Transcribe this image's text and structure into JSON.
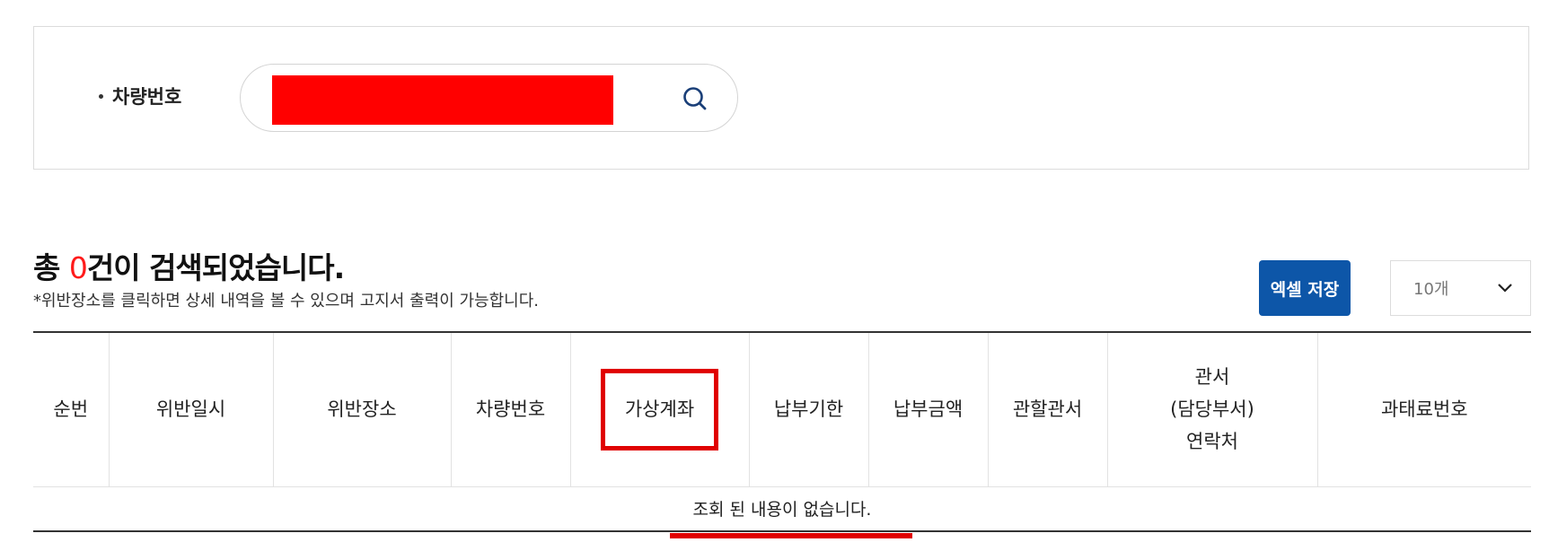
{
  "search": {
    "label": "차량번호",
    "vehicle_value": "",
    "search_icon": "search-icon"
  },
  "result": {
    "prefix": "총 ",
    "count": "0",
    "suffix": "건이 검색되었습니다.",
    "note": "*위반장소를 클릭하면 상세 내역을 볼 수 있으며 고지서 출력이 가능합니다."
  },
  "toolbar": {
    "excel_label": "엑셀 저장",
    "page_size_value": "10개",
    "dropdown_icon": "chevron-down-icon"
  },
  "table": {
    "columns": [
      "순번",
      "위반일시",
      "위반장소",
      "차량번호",
      "가상계좌",
      "납부기한",
      "납부금액",
      "관할관서"
    ],
    "dept_contact_lines": [
      "관서",
      "(담당부서)",
      "연락처"
    ],
    "last_column": "과태료번호",
    "empty_message": "조회 된 내용이 없습니다."
  },
  "colors": {
    "primary_button": "#0d56a8",
    "count_highlight": "#ff1a1a",
    "annotation_red": "#e00000",
    "redaction": "#ff0000"
  }
}
